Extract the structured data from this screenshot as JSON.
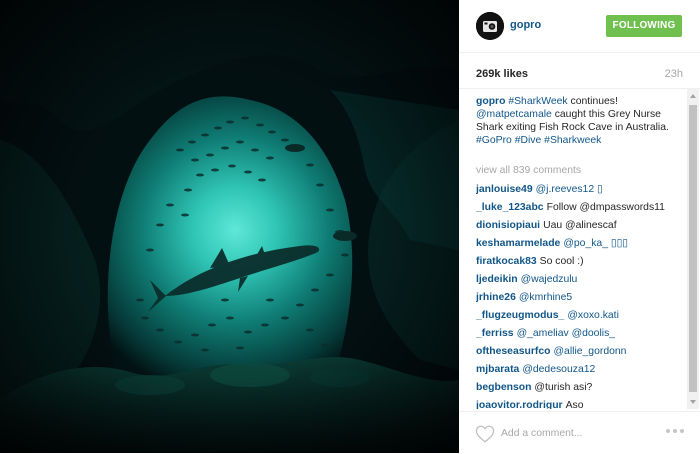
{
  "post": {
    "username": "gopro",
    "follow_label": "FOLLOWING",
    "likes": "269k likes",
    "time": "23h",
    "caption": {
      "user": "gopro",
      "tag1": "#SharkWeek",
      "text1": "continues!",
      "mention": "@matpetcamale",
      "text2": "caught this Grey Nurse Shark exiting Fish Rock Cave in Australia.",
      "tag2": "#GoPro",
      "tag3": "#Dive",
      "tag4": "#Sharkweek"
    },
    "view_all": "view all 839 comments",
    "comments": [
      {
        "user": "janlouise49",
        "text": "@j.reeves12 ▯"
      },
      {
        "user": "_luke_123abc",
        "text": "Follow @dmpasswords11"
      },
      {
        "user": "dionisiopiaui",
        "text": "Uau @alinescaf"
      },
      {
        "user": "keshamarmelade",
        "text": "@po_ka_ ▯▯▯"
      },
      {
        "user": "firatkocak83",
        "text": "So cool :)"
      },
      {
        "user": "ljedeikin",
        "text": "@wajedzulu"
      },
      {
        "user": "jrhine26",
        "text": "@kmrhine5"
      },
      {
        "user": "_flugzeugmodus_",
        "text": "@xoxo.kati"
      },
      {
        "user": "_ferriss",
        "text": "@_ameliav @doolis_"
      },
      {
        "user": "oftheseasurfco",
        "text": "@allie_gordonn"
      },
      {
        "user": "mjbarata",
        "text": "@dedesouza12"
      },
      {
        "user": "begbenson",
        "text": "@turish asi?"
      },
      {
        "user": "joaovitor.rodrigur",
        "text": "Aso"
      }
    ],
    "add_comment_placeholder": "Add a comment..."
  },
  "icons": {
    "avatar": "gopro-camera-logo",
    "like": "heart-icon",
    "more": "more-options-icon"
  },
  "colors": {
    "link": "#125688",
    "follow_button": "#70c050",
    "muted": "#a5a7aa"
  }
}
